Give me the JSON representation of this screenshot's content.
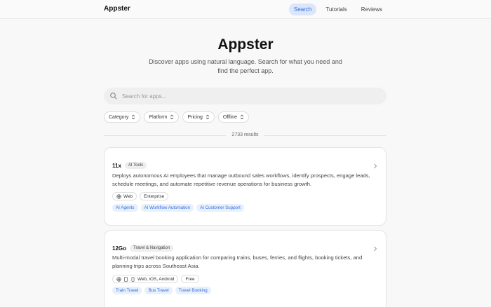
{
  "nav": {
    "brand": "Appster",
    "links": [
      {
        "label": "Search"
      },
      {
        "label": "Tutorials"
      },
      {
        "label": "Reviews"
      }
    ]
  },
  "hero": {
    "title": "Appster",
    "subtitle": "Discover apps using natural language. Search for what you need and find the perfect app."
  },
  "search": {
    "placeholder": "Search for apps...",
    "value": ""
  },
  "filters": [
    {
      "label": "Category"
    },
    {
      "label": "Platform"
    },
    {
      "label": "Pricing"
    },
    {
      "label": "Offline"
    }
  ],
  "results": {
    "count_text": "2733 results"
  },
  "apps": [
    {
      "name": "11x",
      "category": "AI Tools",
      "description": "Deploys autonomous AI employees that manage outbound sales workflows, identify prospects, engage leads, schedule meetings, and automate repetitive revenue operations for business growth.",
      "platforms": "Web",
      "platform_icons": [
        "globe-icon"
      ],
      "pricing": "Enterprise",
      "tags": [
        "AI Agents",
        "AI Workflow Automation",
        "AI Customer Support"
      ]
    },
    {
      "name": "12Go",
      "category": "Travel & Navigation",
      "description": "Multi-modal travel booking application for comparing trains, buses, ferries, and flights, booking tickets, and planning trips across Southeast Asia.",
      "platforms": "Web, iOS, Android",
      "platform_icons": [
        "globe-icon",
        "tablet-icon",
        "phone-icon"
      ],
      "pricing": "Free",
      "tags": [
        "Train Travel",
        "Bus Travel",
        "Travel Booking"
      ]
    }
  ],
  "colors": {
    "accent": "#2f6fe0",
    "accent_bg": "#dbe6fb",
    "tag_bg": "#e8f0fc"
  }
}
